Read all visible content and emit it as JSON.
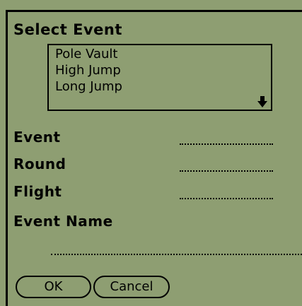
{
  "dialog": {
    "title": "Select Event"
  },
  "event_list": {
    "items": [
      "Pole Vault",
      "High Jump",
      "Long Jump"
    ],
    "scroll_icon": "down-arrow-icon"
  },
  "fields": {
    "event_label": "Event",
    "round_label": "Round",
    "flight_label": "Flight",
    "event_name_label": "Event Name"
  },
  "buttons": {
    "ok_label": "OK",
    "cancel_label": "Cancel"
  }
}
